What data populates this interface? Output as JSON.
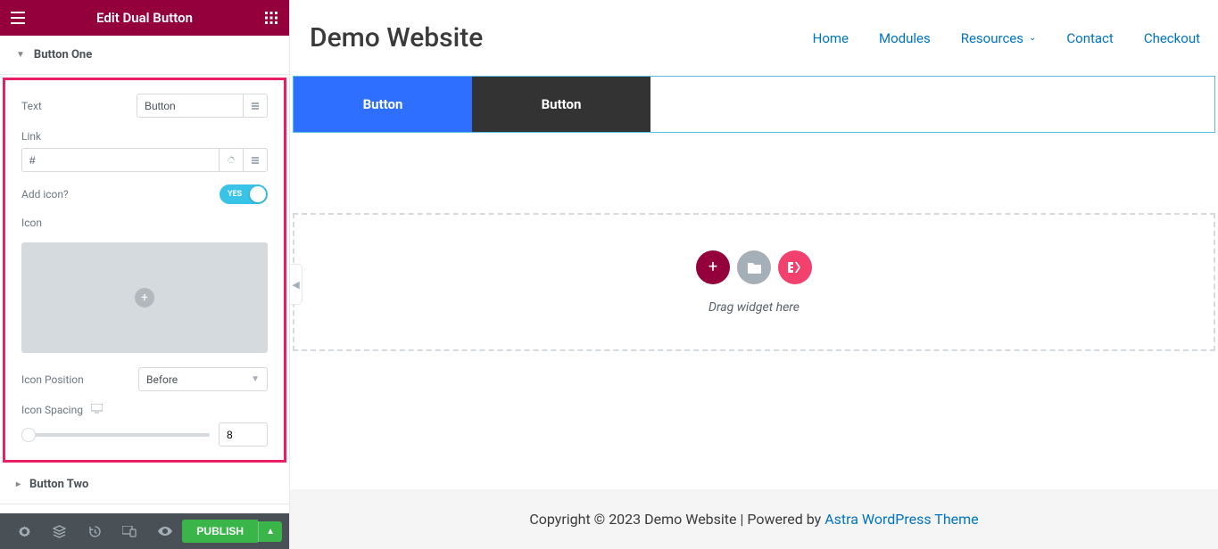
{
  "panel": {
    "title": "Edit Dual Button",
    "accordion": {
      "button_one": "Button One",
      "button_two": "Button Two"
    },
    "controls": {
      "text_label": "Text",
      "text_value": "Button",
      "link_label": "Link",
      "link_value": "#",
      "add_icon_label": "Add icon?",
      "add_icon_toggle": "YES",
      "icon_label": "Icon",
      "icon_position_label": "Icon Position",
      "icon_position_value": "Before",
      "icon_spacing_label": "Icon Spacing",
      "icon_spacing_value": "8"
    },
    "footer": {
      "publish": "PUBLISH"
    }
  },
  "preview": {
    "site_title": "Demo Website",
    "nav": {
      "home": "Home",
      "modules": "Modules",
      "resources": "Resources",
      "contact": "Contact",
      "checkout": "Checkout"
    },
    "buttons": {
      "one": "Button",
      "two": "Button"
    },
    "drop_hint": "Drag widget here",
    "footer": {
      "text": "Copyright © 2023 Demo Website | Powered by ",
      "link": "Astra WordPress Theme"
    }
  }
}
